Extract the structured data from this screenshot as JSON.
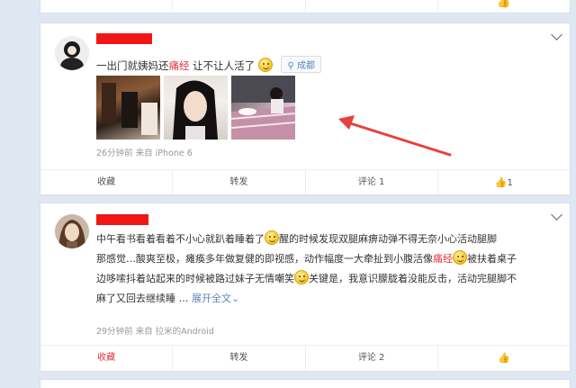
{
  "feed": {
    "posts": [
      {
        "text_before": "一出门就姨妈还",
        "text_highlight": "痛经",
        "text_after": " 让不让人活了",
        "location": "成都",
        "meta": "26分钟前 来自 iPhone 6",
        "actions": {
          "favorite": "收藏",
          "repost": "转发",
          "comment": "评论 1",
          "like": "1"
        }
      },
      {
        "line1": "中午看书看着看着不小心就趴着睡着了",
        "line1b": "醒的时候发现双腿麻痹动弹不得无奈小心活动腿脚",
        "line2a": "那感觉…酸爽至极，瘫痪多年做复健的即视感，动作幅度一大牵扯到小腹活像",
        "line2_highlight": "痛经",
        "line2b": "被扶着桌子",
        "line3a": "边哆嗦抖着站起来的时候被路过妹子无情嘲笑",
        "line3b": "关键是，我意识朦胧着没能反击，活动完腿脚不",
        "line4": "麻了又回去继续睡 …",
        "expand": "展开全文",
        "meta": "29分钟前 来自 拉米的Android",
        "actions": {
          "favorite": "收藏",
          "repost": "转发",
          "comment": "评论 2",
          "like": ""
        }
      }
    ],
    "top_card_actions": {
      "like": ""
    }
  },
  "colors": {
    "accent_red": "#f01616",
    "link_blue": "#5b87b9",
    "arrow": "#e8403a",
    "background": "#dfe7f3"
  },
  "icons": [
    "location-icon",
    "thumbs-up-icon",
    "chevron-down-icon",
    "smile-emoji-icon",
    "expand-chevron-icon"
  ]
}
